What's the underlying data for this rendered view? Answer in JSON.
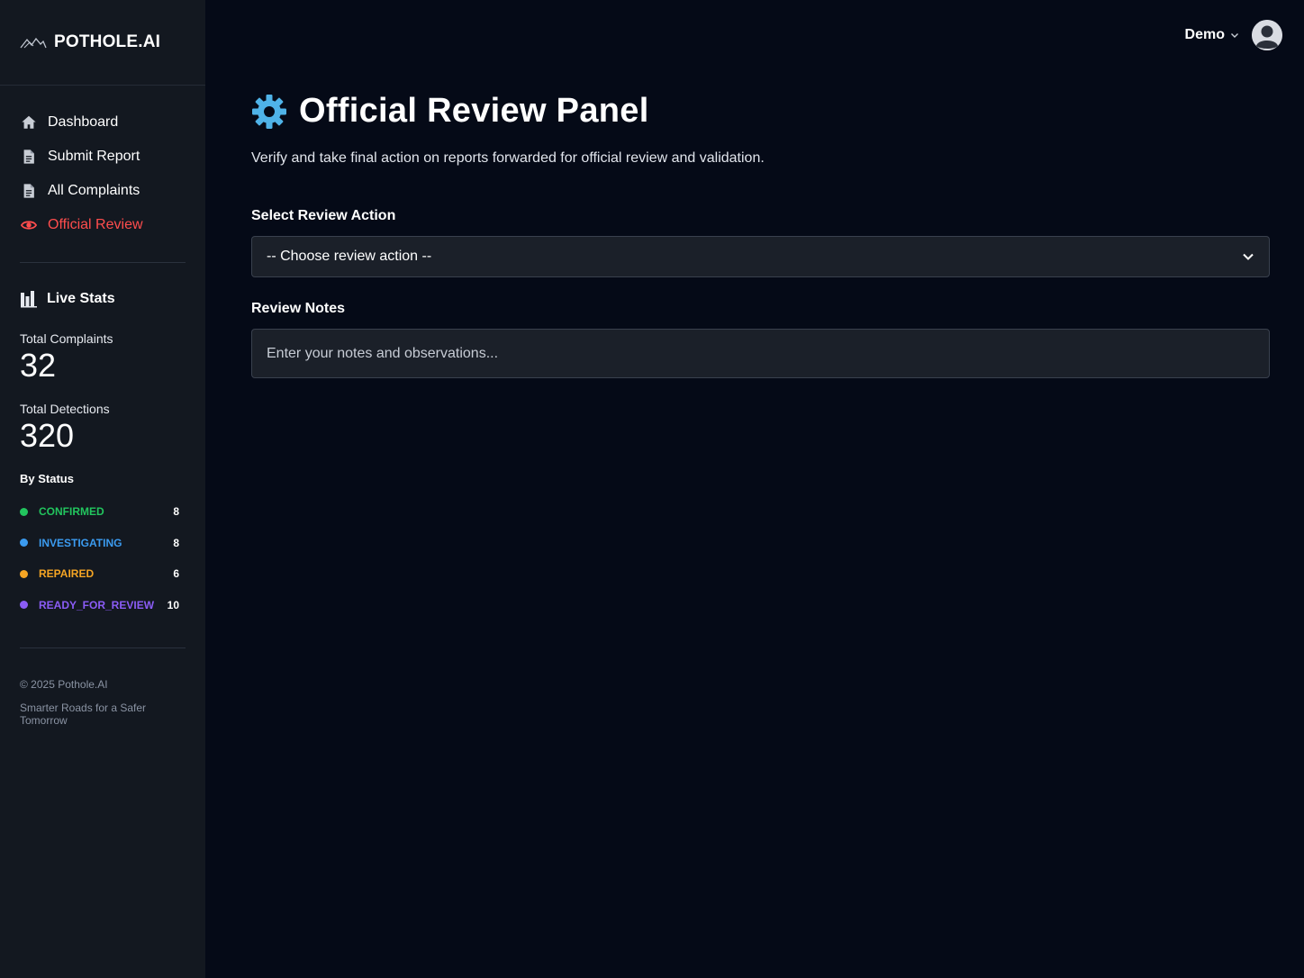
{
  "brand": {
    "name": "POTHOLE.AI",
    "logo_icon": "mountain-logo-icon"
  },
  "nav": {
    "items": [
      {
        "label": "Dashboard",
        "icon": "home-icon",
        "active": false
      },
      {
        "label": "Submit Report",
        "icon": "document-icon",
        "active": false
      },
      {
        "label": "All Complaints",
        "icon": "document-icon",
        "active": false
      },
      {
        "label": "Official Review",
        "icon": "eye-icon",
        "active": true
      }
    ],
    "active_color": "#ff4d4d"
  },
  "stats": {
    "title": "Live Stats",
    "icon": "bar-chart-icon",
    "total_complaints_label": "Total Complaints",
    "total_complaints": "32",
    "total_detections_label": "Total Detections",
    "total_detections": "320",
    "by_status_label": "By Status",
    "statuses": [
      {
        "name": "CONFIRMED",
        "count": "8",
        "color": "#22c55e"
      },
      {
        "name": "INVESTIGATING",
        "count": "8",
        "color": "#3b9bf0"
      },
      {
        "name": "REPAIRED",
        "count": "6",
        "color": "#f5a524"
      },
      {
        "name": "READY_FOR_REVIEW",
        "count": "10",
        "color": "#8b5cf6"
      }
    ]
  },
  "footer": {
    "copyright": "© 2025 Pothole.AI",
    "tagline": "Smarter Roads for a Safer Tomorrow"
  },
  "user": {
    "name": "Demo",
    "avatar_icon": "user-avatar-icon"
  },
  "page": {
    "title": "Official Review Panel",
    "title_icon": "gear-icon",
    "title_icon_color": "#4fb3e8",
    "subtitle": "Verify and take final action on reports forwarded for official review and validation."
  },
  "form": {
    "action_label": "Select Review Action",
    "action_value": "-- Choose review action --",
    "notes_label": "Review Notes",
    "notes_placeholder": "Enter your notes and observations...",
    "notes_value": ""
  }
}
